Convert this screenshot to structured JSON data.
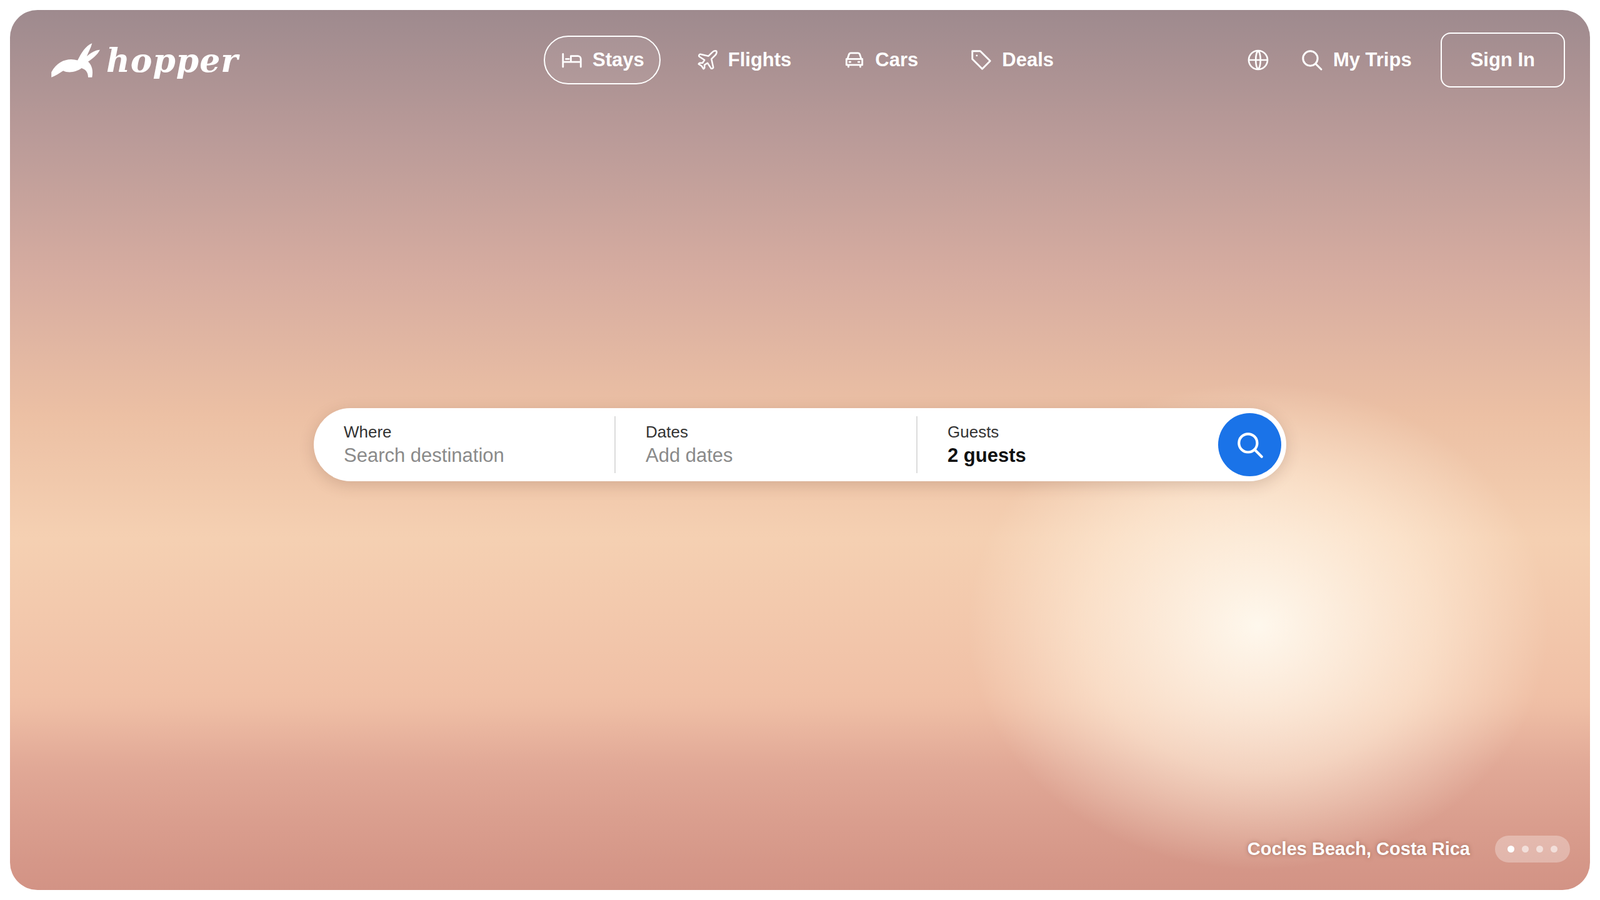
{
  "logo": {
    "text": "hopper"
  },
  "nav": {
    "tabs": [
      {
        "label": "Stays",
        "selected": true
      },
      {
        "label": "Flights",
        "selected": false
      },
      {
        "label": "Cars",
        "selected": false
      },
      {
        "label": "Deals",
        "selected": false
      }
    ],
    "my_trips": "My Trips",
    "sign_in": "Sign In"
  },
  "search": {
    "fields": [
      {
        "label": "Where",
        "value": "Search destination",
        "placeholder": true
      },
      {
        "label": "Dates",
        "value": "Add dates",
        "placeholder": true
      },
      {
        "label": "Guests",
        "value": "2 guests",
        "placeholder": false
      }
    ]
  },
  "hero": {
    "caption": "Cocles Beach, Costa Rica",
    "slides": [
      {
        "selected": true
      },
      {
        "selected": false
      },
      {
        "selected": false
      },
      {
        "selected": false
      }
    ]
  }
}
